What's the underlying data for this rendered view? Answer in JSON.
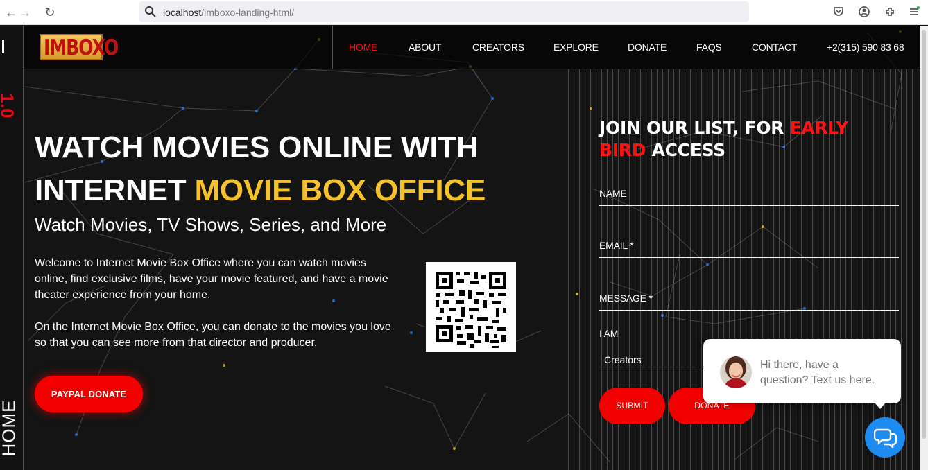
{
  "browser": {
    "url_host": "localhost",
    "url_path": "/imboxo-landing-html/"
  },
  "rail": {
    "version": "1.0",
    "section": "HOME"
  },
  "header": {
    "logo_text": "IMBOXO",
    "nav": [
      {
        "label": "HOME",
        "active": true
      },
      {
        "label": "ABOUT",
        "active": false
      },
      {
        "label": "CREATORS",
        "active": false
      },
      {
        "label": "EXPLORE",
        "active": false
      },
      {
        "label": "DONATE",
        "active": false
      },
      {
        "label": "FAQS",
        "active": false
      },
      {
        "label": "CONTACT",
        "active": false
      }
    ],
    "phone": "+2(315) 590 83 68"
  },
  "hero": {
    "title_line_1": "WATCH MOVIES ONLINE WITH",
    "title_line_2_prefix": "INTERNET ",
    "title_line_2_highlight": "MOVIE BOX OFFICE",
    "subtitle": "Watch Movies, TV Shows, Series, and More",
    "paragraph_1": "Welcome to Internet Movie Box Office where you can watch movies online, find exclusive films, have your movie featured, and have a movie theater experience from your home.",
    "paragraph_2": "On the Internet Movie Box Office, you can donate to the movies you love so that you can see more from that director and producer.",
    "paypal_button": "PAYPAL DONATE"
  },
  "form": {
    "title_prefix": "JOIN OUR LIST, FOR ",
    "title_highlight": "EARLY BIRD",
    "title_suffix": " ACCESS",
    "name_label": "NAME",
    "email_label": "EMAIL *",
    "message_label": "MESSAGE *",
    "i_am_label": "I AM",
    "selected_role": "Creators",
    "submit_button": "SUBMIT",
    "donate_button": "DONATE"
  },
  "chat": {
    "message": "Hi there, have a question? Text us here."
  },
  "colors": {
    "accent_red": "#f20000",
    "highlight_yellow": "#f5c22b",
    "background": "#141414",
    "chat_blue": "#1e8bf0"
  }
}
